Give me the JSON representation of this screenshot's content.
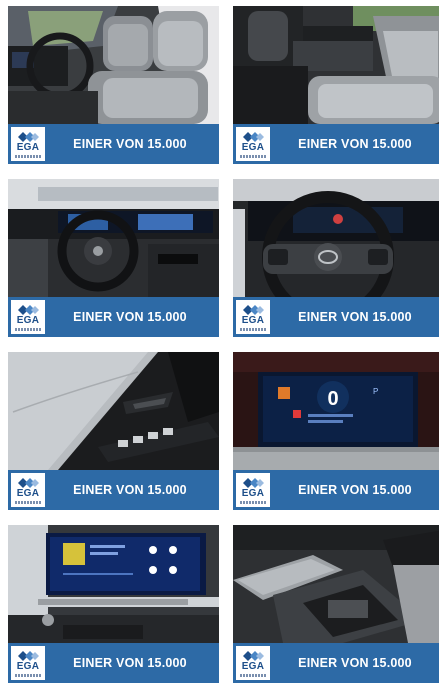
{
  "gallery": {
    "brand": {
      "logo_text": "EGA",
      "blue": "#2d6aa6",
      "logo_text_color": "#1d4f8a"
    },
    "banner_text": "EINER VON 15.000",
    "tiles": [
      {
        "photo": "driver-seat-photo"
      },
      {
        "photo": "rear-seats-photo"
      },
      {
        "photo": "cockpit-photo"
      },
      {
        "photo": "steering-wheel-photo"
      },
      {
        "photo": "door-panel-photo"
      },
      {
        "photo": "instrument-cluster-photo"
      },
      {
        "photo": "infotainment-screen-photo"
      },
      {
        "photo": "center-console-photo"
      }
    ]
  },
  "cluster": {
    "speed": "0",
    "gear": "P"
  }
}
